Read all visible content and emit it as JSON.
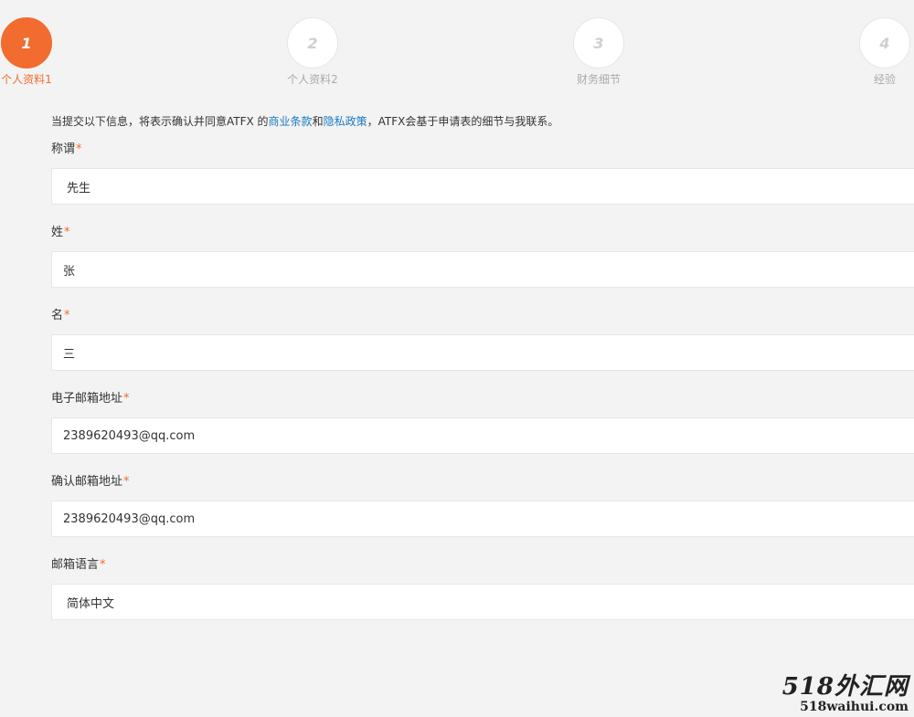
{
  "steps": [
    {
      "number": "1",
      "label": "个人资料1",
      "active": true
    },
    {
      "number": "2",
      "label": "个人资料2",
      "active": false
    },
    {
      "number": "3",
      "label": "财务细节",
      "active": false
    },
    {
      "number": "4",
      "label": "经验",
      "active": false
    }
  ],
  "notice": {
    "prefix": "当提交以下信息，将表示确认并同意ATFX 的",
    "terms_link": "商业条款",
    "conj": "和",
    "privacy_link": "隐私政策",
    "suffix": "，ATFX会基于申请表的细节与我联系。"
  },
  "required_marker": "*",
  "fields": {
    "title": {
      "label": "称谓",
      "value": "先生"
    },
    "last_name": {
      "label": "姓",
      "value": "张"
    },
    "first_name": {
      "label": "名",
      "value": "三"
    },
    "email": {
      "label": "电子邮箱地址",
      "value": "2389620493@qq.com"
    },
    "confirm_email": {
      "label": "确认邮箱地址",
      "value": "2389620493@qq.com"
    },
    "email_language": {
      "label": "邮箱语言",
      "value": "简体中文"
    }
  },
  "watermark": {
    "main": "518外汇网",
    "sub": "518waihui.com"
  },
  "colors": {
    "accent": "#f26b2f",
    "link": "#1a7bc4",
    "background": "#f3f3f3"
  }
}
